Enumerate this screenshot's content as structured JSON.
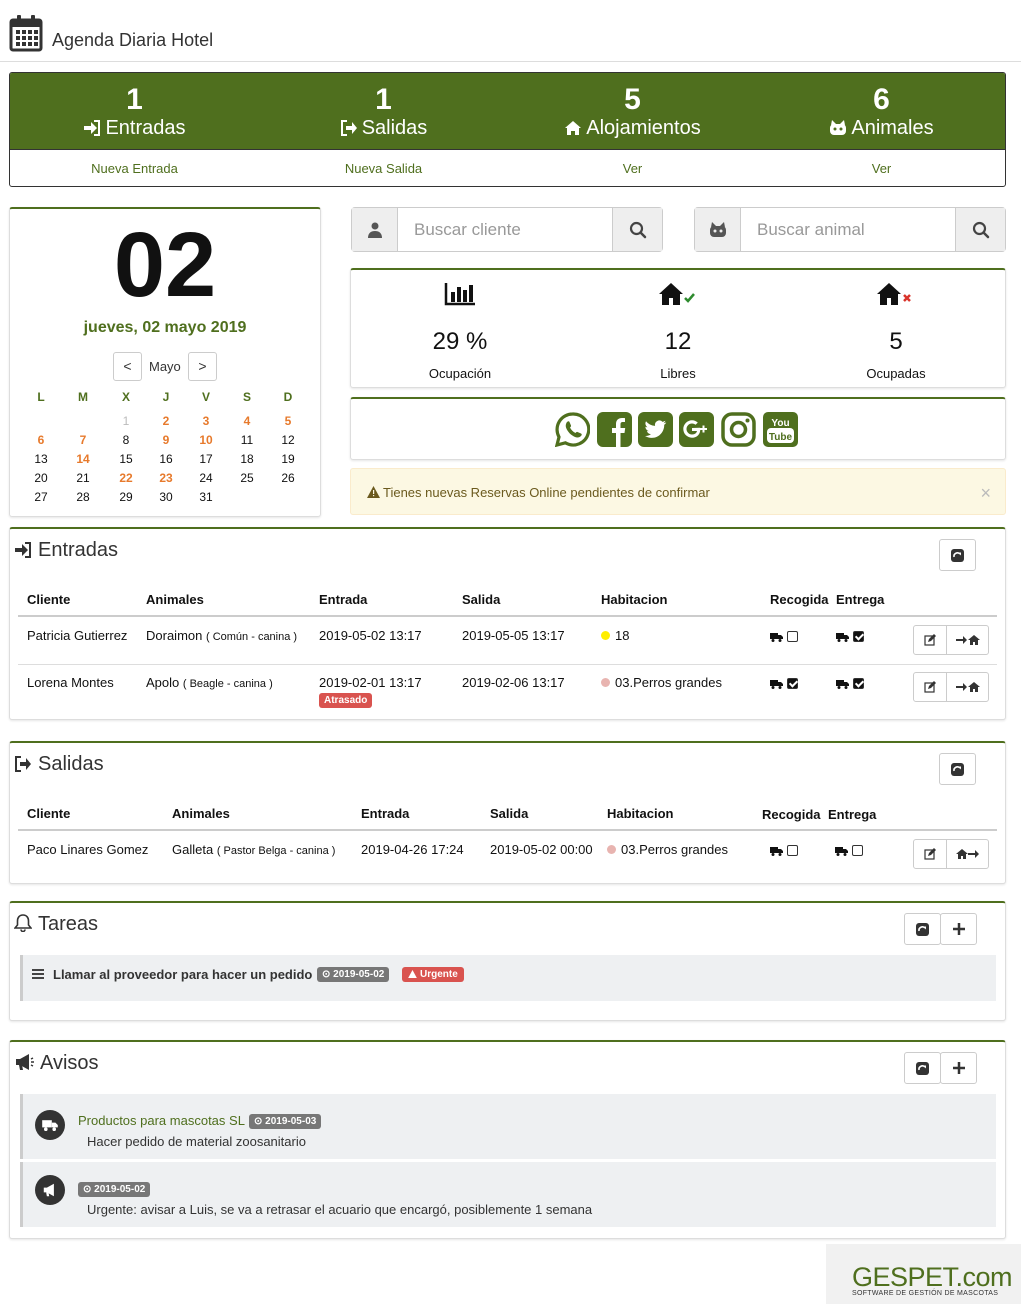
{
  "app": {
    "title": "Agenda Diaria Hotel"
  },
  "stats": [
    {
      "num": "1",
      "label": "Entradas",
      "link": "Nueva Entrada"
    },
    {
      "num": "1",
      "label": "Salidas",
      "link": "Nueva Salida"
    },
    {
      "num": "5",
      "label": "Alojamientos",
      "link": "Ver"
    },
    {
      "num": "6",
      "label": "Animales",
      "link": "Ver"
    }
  ],
  "calendar": {
    "day": "02",
    "date_text": "jueves, 02 mayo 2019",
    "month": "Mayo",
    "prev": "<",
    "next": ">",
    "weekdays": [
      "L",
      "M",
      "X",
      "J",
      "V",
      "S",
      "D"
    ],
    "weeks": [
      [
        "",
        "",
        "1",
        "2",
        "3",
        "4",
        "5"
      ],
      [
        "6",
        "7",
        "8",
        "9",
        "10",
        "11",
        "12"
      ],
      [
        "13",
        "14",
        "15",
        "16",
        "17",
        "18",
        "19"
      ],
      [
        "20",
        "21",
        "22",
        "23",
        "24",
        "25",
        "26"
      ],
      [
        "27",
        "28",
        "29",
        "30",
        "31",
        "",
        ""
      ]
    ],
    "highlighted": [
      "2",
      "3",
      "4",
      "5",
      "6",
      "7",
      "9",
      "10",
      "14",
      "22",
      "23"
    ],
    "muted": [
      "1"
    ]
  },
  "search": {
    "client_placeholder": "Buscar cliente",
    "animal_placeholder": "Buscar animal"
  },
  "occupancy": [
    {
      "icon": "bar-chart-icon",
      "value": "29 %",
      "label": "Ocupación"
    },
    {
      "icon": "home-check-icon",
      "value": "12",
      "label": "Libres"
    },
    {
      "icon": "home-x-icon",
      "value": "5",
      "label": "Ocupadas"
    }
  ],
  "social": [
    "whatsapp-icon",
    "facebook-icon",
    "twitter-icon",
    "google-plus-icon",
    "instagram-icon",
    "youtube-icon"
  ],
  "alert": {
    "text": "Tienes nuevas Reservas Online pendientes de confirmar",
    "close": "×"
  },
  "entradas": {
    "title": "Entradas",
    "headers": [
      "Cliente",
      "Animales",
      "Entrada",
      "Salida",
      "Habitacion",
      "Recogida",
      "Entrega"
    ],
    "rows": [
      {
        "cliente": "Patricia Gutierrez",
        "animal": "Doraimon",
        "detalle": "( Común - canina )",
        "entrada": "2019-05-02 13:17",
        "salida": "2019-05-05 13:17",
        "habitacion": "18",
        "hab_color": "#ffee00",
        "recogida": false,
        "entrega": true,
        "badge": ""
      },
      {
        "cliente": "Lorena Montes",
        "animal": "Apolo",
        "detalle": "( Beagle - canina )",
        "entrada": "2019-02-01 13:17",
        "salida": "2019-02-06 13:17",
        "habitacion": "03.Perros grandes",
        "hab_color": "#e8b4b0",
        "recogida": true,
        "entrega": true,
        "badge": "Atrasado"
      }
    ]
  },
  "salidas": {
    "title": "Salidas",
    "headers": [
      "Cliente",
      "Animales",
      "Entrada",
      "Salida",
      "Habitacion",
      "Recogida",
      "Entrega"
    ],
    "rows": [
      {
        "cliente": "Paco Linares Gomez",
        "animal": "Galleta",
        "detalle": "( Pastor Belga - canina )",
        "entrada": "2019-04-26 17:24",
        "salida": "2019-05-02 00:00",
        "habitacion": "03.Perros grandes",
        "hab_color": "#e8b4b0",
        "recogida": false,
        "entrega": false
      }
    ]
  },
  "tareas": {
    "title": "Tareas",
    "items": [
      {
        "text": "Llamar al proveedor para hacer un pedido",
        "date": "2019-05-02",
        "badge": "Urgente"
      }
    ]
  },
  "avisos": {
    "title": "Avisos",
    "items": [
      {
        "icon": "truck-icon",
        "title": "Productos para mascotas SL",
        "date": "2019-05-03",
        "text": "Hacer pedido de material zoosanitario"
      },
      {
        "icon": "bullhorn-icon",
        "title": "",
        "date": "2019-05-02",
        "text": "Urgente: avisar a Luis, se va a retrasar el acuario que encargó, posiblemente 1 semana"
      }
    ]
  },
  "logo": {
    "brand": "GESPET.com",
    "tagline": "SOFTWARE DE GESTIÓN DE MASCOTAS"
  },
  "colors": {
    "primary": "#4f6f1e",
    "accent_orange": "#e77a2c",
    "danger": "#d9534f",
    "alert_bg": "#fcf8e3"
  }
}
